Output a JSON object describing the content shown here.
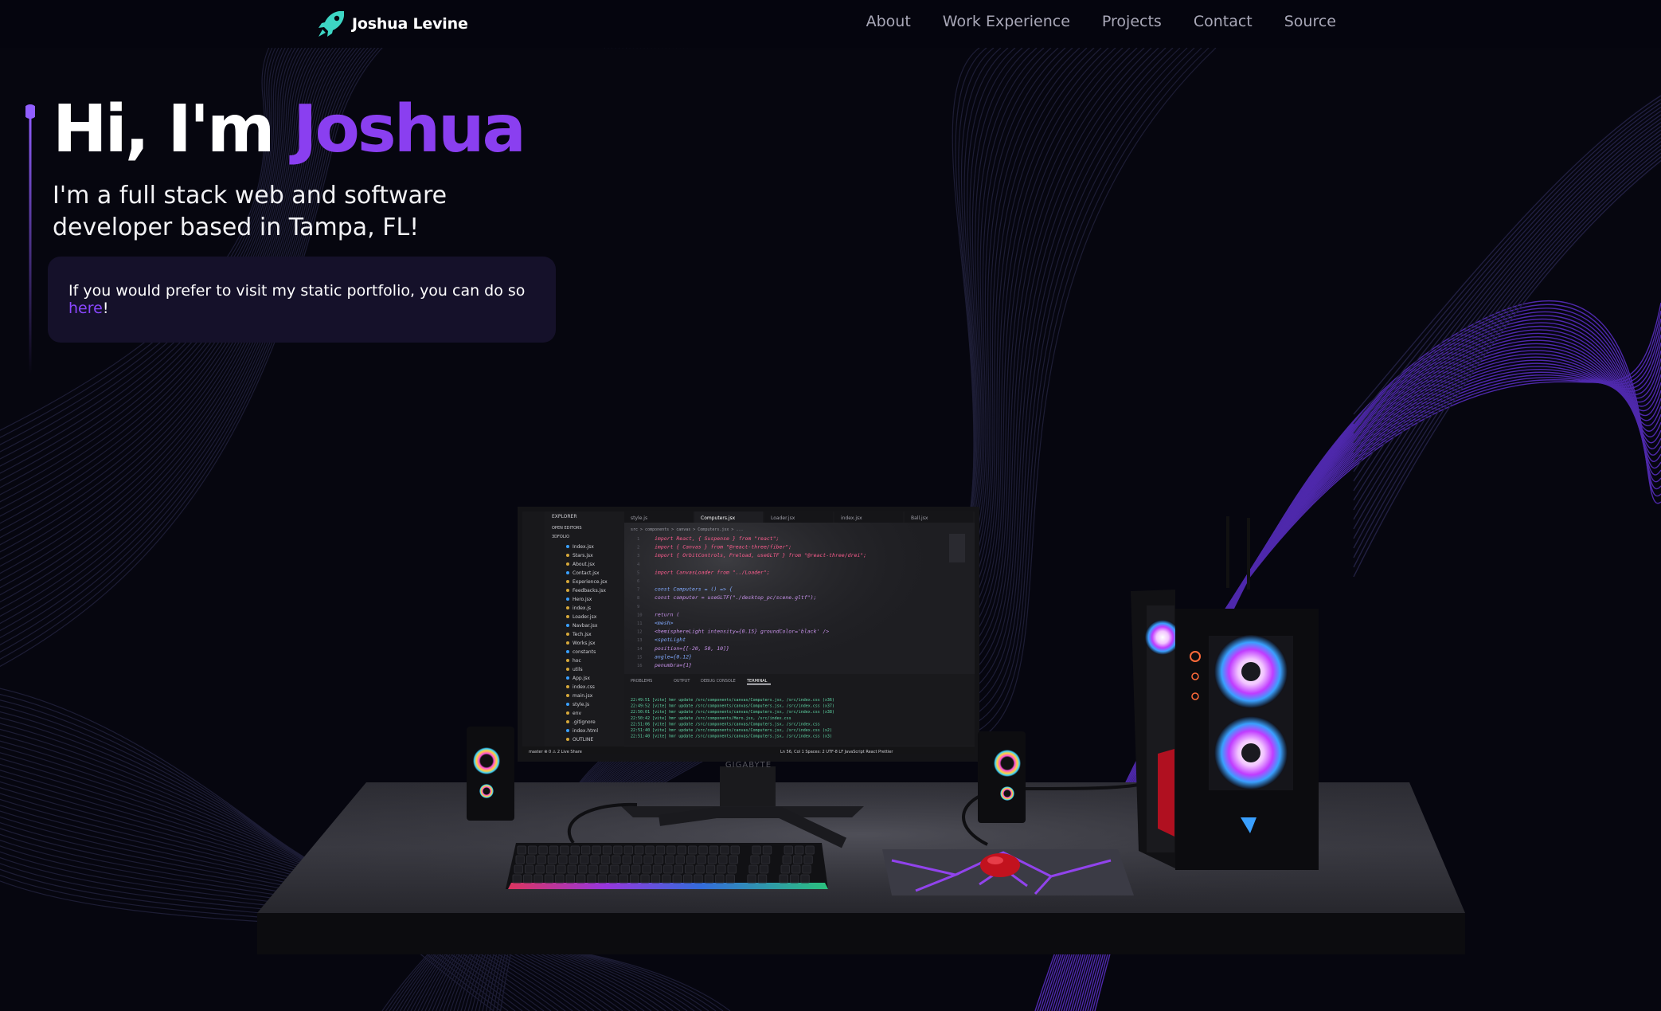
{
  "navbar": {
    "brand_name": "Joshua Levine",
    "links": [
      "About",
      "Work Experience",
      "Projects",
      "Contact",
      "Source"
    ]
  },
  "hero": {
    "title_prefix": "Hi, I'm ",
    "title_name": "Joshua",
    "subtitle": "I'm a full stack web and software developer based in Tampa, FL!",
    "static_note_prefix": "If you would prefer to visit my static portfolio, you can do so ",
    "static_note_link": "here",
    "static_note_suffix": "!"
  },
  "scene": {
    "monitor_brand": "GIGABYTE",
    "editor": {
      "explorer_label": "EXPLORER",
      "open_editors_label": "OPEN EDITORS",
      "project_label": "3DFOLIO",
      "files": [
        "Index.jsx",
        "Stars.jsx",
        "About.jsx",
        "Contact.jsx",
        "Experience.jsx",
        "Feedbacks.jsx",
        "Hero.jsx",
        "index.js",
        "Loader.jsx",
        "Navbar.jsx",
        "Tech.jsx",
        "Works.jsx",
        "constants",
        "hoc",
        "utils",
        "App.jsx",
        "index.css",
        "main.jsx",
        "style.js",
        "env",
        ".gitignore",
        "index.html",
        "OUTLINE"
      ],
      "tabs": [
        "style.js",
        "Computers.jsx",
        "Loader.jsx",
        "index.jsx",
        "Ball.jsx"
      ],
      "breadcrumb": "src > components > canvas > Computers.jsx > ...",
      "code_lines": [
        "import React, { Suspense } from \"react\";",
        "import { Canvas } from \"@react-three/fiber\";",
        "import { OrbitControls, Preload, useGLTF } from \"@react-three/drei\";",
        "",
        "import CanvasLoader from \"../Loader\";",
        "",
        "const Computers = () => {",
        "  const computer = useGLTF(\"./desktop_pc/scene.gltf\");",
        "",
        "  return (",
        "    <mesh>",
        "      <hemisphereLight intensity={0.15} groundColor='black' />",
        "      <spotLight",
        "        position={[-20, 50, 10]}",
        "        angle={0.12}",
        "        penumbra={1}"
      ],
      "panel_tabs": [
        "PROBLEMS",
        "OUTPUT",
        "DEBUG CONSOLE",
        "TERMINAL"
      ],
      "terminal_lines": [
        "22:49:51 [vite] hmr update /src/components/canvas/Computers.jsx, /src/index.css (x36)",
        "22:49:52 [vite] hmr update /src/components/canvas/Computers.jsx, /src/index.css (x37)",
        "22:50:01 [vite] hmr update /src/components/canvas/Computers.jsx, /src/index.css (x38)",
        "22:50:42 [vite] hmr update /src/components/Hero.jsx, /src/index.css",
        "22:51:06 [vite] hmr update /src/components/canvas/Computers.jsx, /src/index.css",
        "22:51:40 [vite] hmr update /src/components/canvas/Computers.jsx, /src/index.css (x2)",
        "22:51:40 [vite] hmr update /src/components/canvas/Computers.jsx, /src/index.css (x3)"
      ],
      "status_left": "master  ⊗ 0 ⚠ 2  Live Share",
      "status_right": "Ln 56, Col 1  Spaces: 2  UTF-8  LF  JavaScript React  Prettier"
    }
  },
  "colors": {
    "background": "#06060f",
    "accent": "#8a3ff0",
    "link": "#8a47ff",
    "card": "#15112a",
    "nav_text": "#a9a8b8",
    "logo": "#3dd6c4"
  }
}
